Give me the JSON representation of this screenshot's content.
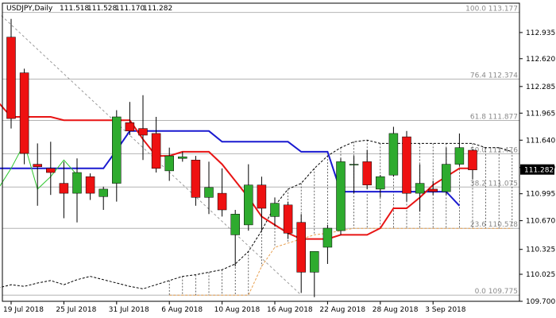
{
  "chart_data": {
    "type": "candlestick",
    "title": "USDJPY,Daily",
    "ohlc_text": [
      "111.518",
      "111.528",
      "111.170",
      "111.282"
    ],
    "current_price": "111.282",
    "ylim": [
      109.7,
      113.25
    ],
    "yticks": [
      "112.935",
      "112.620",
      "112.285",
      "111.965",
      "111.640",
      "111.310",
      "110.995",
      "110.670",
      "110.325",
      "110.025",
      "109.700"
    ],
    "xticks": [
      {
        "label": "19 Jul 2018",
        "index": 0
      },
      {
        "label": "25 Jul 2018",
        "index": 4
      },
      {
        "label": "31 Jul 2018",
        "index": 8
      },
      {
        "label": "6 Aug 2018",
        "index": 12
      },
      {
        "label": "10 Aug 2018",
        "index": 16
      },
      {
        "label": "16 Aug 2018",
        "index": 20
      },
      {
        "label": "22 Aug 2018",
        "index": 24
      },
      {
        "label": "28 Aug 2018",
        "index": 28
      },
      {
        "label": "3 Sep 2018",
        "index": 32
      }
    ],
    "fibonacci": [
      {
        "label": "100.0 113.177",
        "value": 113.177
      },
      {
        "label": "76.4 112.374",
        "value": 112.374
      },
      {
        "label": "61.8 111.877",
        "value": 111.877
      },
      {
        "label": "50.0 111.476",
        "value": 111.476
      },
      {
        "label": "38.2 111.075",
        "value": 111.075
      },
      {
        "label": "23.6 110.578",
        "value": 110.578
      },
      {
        "label": "0.0 109.775",
        "value": 109.775
      }
    ],
    "candles": [
      {
        "o": 112.88,
        "h": 113.1,
        "l": 111.78,
        "c": 111.9
      },
      {
        "o": 112.45,
        "h": 112.5,
        "l": 111.35,
        "c": 111.48
      },
      {
        "o": 111.35,
        "h": 111.6,
        "l": 110.85,
        "c": 111.32
      },
      {
        "o": 111.3,
        "h": 111.62,
        "l": 110.98,
        "c": 111.25
      },
      {
        "o": 111.12,
        "h": 111.38,
        "l": 110.7,
        "c": 111.0
      },
      {
        "o": 111.0,
        "h": 111.42,
        "l": 110.65,
        "c": 111.25
      },
      {
        "o": 111.2,
        "h": 111.24,
        "l": 110.92,
        "c": 111.0
      },
      {
        "o": 110.96,
        "h": 111.08,
        "l": 110.8,
        "c": 111.05
      },
      {
        "o": 111.12,
        "h": 112.0,
        "l": 110.9,
        "c": 111.92
      },
      {
        "o": 111.85,
        "h": 112.1,
        "l": 111.7,
        "c": 111.75
      },
      {
        "o": 111.78,
        "h": 112.18,
        "l": 111.4,
        "c": 111.7
      },
      {
        "o": 111.72,
        "h": 111.92,
        "l": 111.25,
        "c": 111.3
      },
      {
        "o": 111.27,
        "h": 111.55,
        "l": 111.15,
        "c": 111.45
      },
      {
        "o": 111.42,
        "h": 111.5,
        "l": 111.38,
        "c": 111.44
      },
      {
        "o": 111.4,
        "h": 111.45,
        "l": 110.85,
        "c": 110.95
      },
      {
        "o": 110.95,
        "h": 111.38,
        "l": 110.75,
        "c": 111.07
      },
      {
        "o": 111.0,
        "h": 111.3,
        "l": 110.72,
        "c": 110.8
      },
      {
        "o": 110.5,
        "h": 110.8,
        "l": 110.12,
        "c": 110.75
      },
      {
        "o": 110.62,
        "h": 111.35,
        "l": 110.55,
        "c": 111.1
      },
      {
        "o": 111.1,
        "h": 111.2,
        "l": 110.55,
        "c": 110.82
      },
      {
        "o": 110.72,
        "h": 110.95,
        "l": 110.6,
        "c": 110.88
      },
      {
        "o": 110.86,
        "h": 110.9,
        "l": 110.45,
        "c": 110.52
      },
      {
        "o": 110.65,
        "h": 110.75,
        "l": 109.8,
        "c": 110.05
      },
      {
        "o": 110.05,
        "h": 110.3,
        "l": 109.75,
        "c": 110.3
      },
      {
        "o": 110.35,
        "h": 110.62,
        "l": 110.15,
        "c": 110.58
      },
      {
        "o": 110.55,
        "h": 111.42,
        "l": 110.5,
        "c": 111.38
      },
      {
        "o": 111.35,
        "h": 111.45,
        "l": 111.0,
        "c": 111.35
      },
      {
        "o": 111.38,
        "h": 111.52,
        "l": 111.05,
        "c": 111.1
      },
      {
        "o": 111.05,
        "h": 111.22,
        "l": 110.95,
        "c": 111.2
      },
      {
        "o": 111.22,
        "h": 111.8,
        "l": 111.2,
        "c": 111.72
      },
      {
        "o": 111.68,
        "h": 111.75,
        "l": 110.9,
        "c": 111.0
      },
      {
        "o": 111.0,
        "h": 111.35,
        "l": 110.78,
        "c": 111.12
      },
      {
        "o": 111.05,
        "h": 111.15,
        "l": 110.98,
        "c": 111.02
      },
      {
        "o": 111.02,
        "h": 111.55,
        "l": 110.98,
        "c": 111.35
      },
      {
        "o": 111.35,
        "h": 111.72,
        "l": 111.33,
        "c": 111.55
      },
      {
        "o": 111.518,
        "h": 111.528,
        "l": 111.17,
        "c": 111.282
      }
    ],
    "ichimoku": {
      "tenkan": [
        [
          -1,
          112.1
        ],
        [
          0,
          111.92
        ],
        [
          1,
          111.92
        ],
        [
          2,
          111.92
        ],
        [
          3,
          111.92
        ],
        [
          4,
          111.88
        ],
        [
          5,
          111.88
        ],
        [
          6,
          111.88
        ],
        [
          7,
          111.88
        ],
        [
          8,
          111.88
        ],
        [
          9,
          111.88
        ],
        [
          10,
          111.65
        ],
        [
          11,
          111.45
        ],
        [
          12,
          111.45
        ],
        [
          13,
          111.5
        ],
        [
          14,
          111.5
        ],
        [
          15,
          111.5
        ],
        [
          16,
          111.35
        ],
        [
          17,
          111.15
        ],
        [
          18,
          110.95
        ],
        [
          19,
          110.72
        ],
        [
          20,
          110.62
        ],
        [
          21,
          110.52
        ],
        [
          22,
          110.45
        ],
        [
          23,
          110.45
        ],
        [
          24,
          110.45
        ],
        [
          25,
          110.5
        ],
        [
          26,
          110.5
        ],
        [
          27,
          110.5
        ],
        [
          28,
          110.58
        ],
        [
          29,
          110.82
        ],
        [
          30,
          110.82
        ],
        [
          31,
          110.95
        ],
        [
          32,
          111.1
        ],
        [
          33,
          111.2
        ],
        [
          34,
          111.3
        ],
        [
          35,
          111.3
        ]
      ],
      "kijun": [
        [
          -1,
          111.3
        ],
        [
          0,
          111.3
        ],
        [
          1,
          111.3
        ],
        [
          2,
          111.3
        ],
        [
          3,
          111.3
        ],
        [
          4,
          111.3
        ],
        [
          5,
          111.3
        ],
        [
          6,
          111.3
        ],
        [
          7,
          111.3
        ],
        [
          8,
          111.52
        ],
        [
          9,
          111.75
        ],
        [
          10,
          111.75
        ],
        [
          11,
          111.75
        ],
        [
          12,
          111.75
        ],
        [
          13,
          111.75
        ],
        [
          14,
          111.75
        ],
        [
          15,
          111.75
        ],
        [
          16,
          111.62
        ],
        [
          17,
          111.62
        ],
        [
          18,
          111.62
        ],
        [
          19,
          111.62
        ],
        [
          20,
          111.62
        ],
        [
          21,
          111.62
        ],
        [
          22,
          111.5
        ],
        [
          23,
          111.5
        ],
        [
          24,
          111.5
        ],
        [
          25,
          111.02
        ],
        [
          26,
          111.02
        ],
        [
          27,
          111.02
        ],
        [
          28,
          111.02
        ],
        [
          29,
          111.02
        ],
        [
          30,
          111.02
        ],
        [
          31,
          111.02
        ],
        [
          32,
          111.02
        ],
        [
          33,
          111.02
        ],
        [
          34,
          110.85
        ]
      ],
      "chikou": [
        [
          -1,
          111.05
        ],
        [
          0,
          111.3
        ],
        [
          1,
          111.6
        ],
        [
          2,
          111.05
        ],
        [
          3,
          111.2
        ],
        [
          4,
          111.4
        ],
        [
          5,
          111.22
        ]
      ],
      "span_a": [
        [
          -1,
          109.86
        ],
        [
          0,
          109.9
        ],
        [
          1,
          109.88
        ],
        [
          2,
          109.92
        ],
        [
          3,
          109.95
        ],
        [
          4,
          109.9
        ],
        [
          5,
          109.96
        ],
        [
          6,
          110.0
        ],
        [
          7,
          109.96
        ],
        [
          8,
          109.92
        ],
        [
          9,
          109.88
        ],
        [
          10,
          109.85
        ],
        [
          11,
          109.9
        ],
        [
          12,
          109.95
        ],
        [
          13,
          110.0
        ],
        [
          14,
          110.02
        ],
        [
          15,
          110.05
        ],
        [
          16,
          110.08
        ],
        [
          17,
          110.15
        ],
        [
          18,
          110.3
        ],
        [
          19,
          110.55
        ],
        [
          20,
          110.85
        ],
        [
          21,
          111.05
        ],
        [
          22,
          111.12
        ],
        [
          23,
          111.3
        ],
        [
          24,
          111.45
        ],
        [
          25,
          111.55
        ],
        [
          26,
          111.62
        ],
        [
          27,
          111.64
        ],
        [
          28,
          111.6
        ],
        [
          29,
          111.6
        ],
        [
          30,
          111.6
        ],
        [
          31,
          111.6
        ],
        [
          32,
          111.6
        ],
        [
          33,
          111.6
        ],
        [
          34,
          111.6
        ],
        [
          35,
          111.6
        ],
        [
          36,
          111.55
        ],
        [
          37,
          111.55
        ],
        [
          38,
          111.5
        ]
      ],
      "span_b": [
        [
          12,
          109.775
        ],
        [
          13,
          109.775
        ],
        [
          14,
          109.775
        ],
        [
          15,
          109.775
        ],
        [
          16,
          109.775
        ],
        [
          17,
          109.775
        ],
        [
          18,
          109.775
        ],
        [
          19,
          110.12
        ],
        [
          20,
          110.35
        ],
        [
          21,
          110.4
        ],
        [
          22,
          110.45
        ],
        [
          23,
          110.5
        ],
        [
          24,
          110.52
        ],
        [
          25,
          110.55
        ],
        [
          26,
          110.578
        ],
        [
          27,
          110.578
        ],
        [
          28,
          110.578
        ],
        [
          29,
          110.578
        ],
        [
          30,
          110.578
        ],
        [
          31,
          110.578
        ],
        [
          32,
          110.578
        ],
        [
          33,
          110.578
        ],
        [
          34,
          110.578
        ],
        [
          35,
          110.578
        ],
        [
          36,
          110.578
        ],
        [
          37,
          110.578
        ],
        [
          38,
          110.578
        ]
      ],
      "diagonal": [
        [
          -1,
          113.177
        ],
        [
          22,
          109.775
        ]
      ]
    },
    "colors": {
      "bull": "#2eab2e",
      "bear": "#ee1111",
      "tenkan": "#e81414",
      "kijun": "#1a1ad0",
      "chikou": "#2cc62c",
      "span_a": "#000000",
      "span_b": "#e8a050",
      "fib_line": "#b4b4b4",
      "grid": "#000000",
      "price_tag_bg": "#000000"
    }
  }
}
